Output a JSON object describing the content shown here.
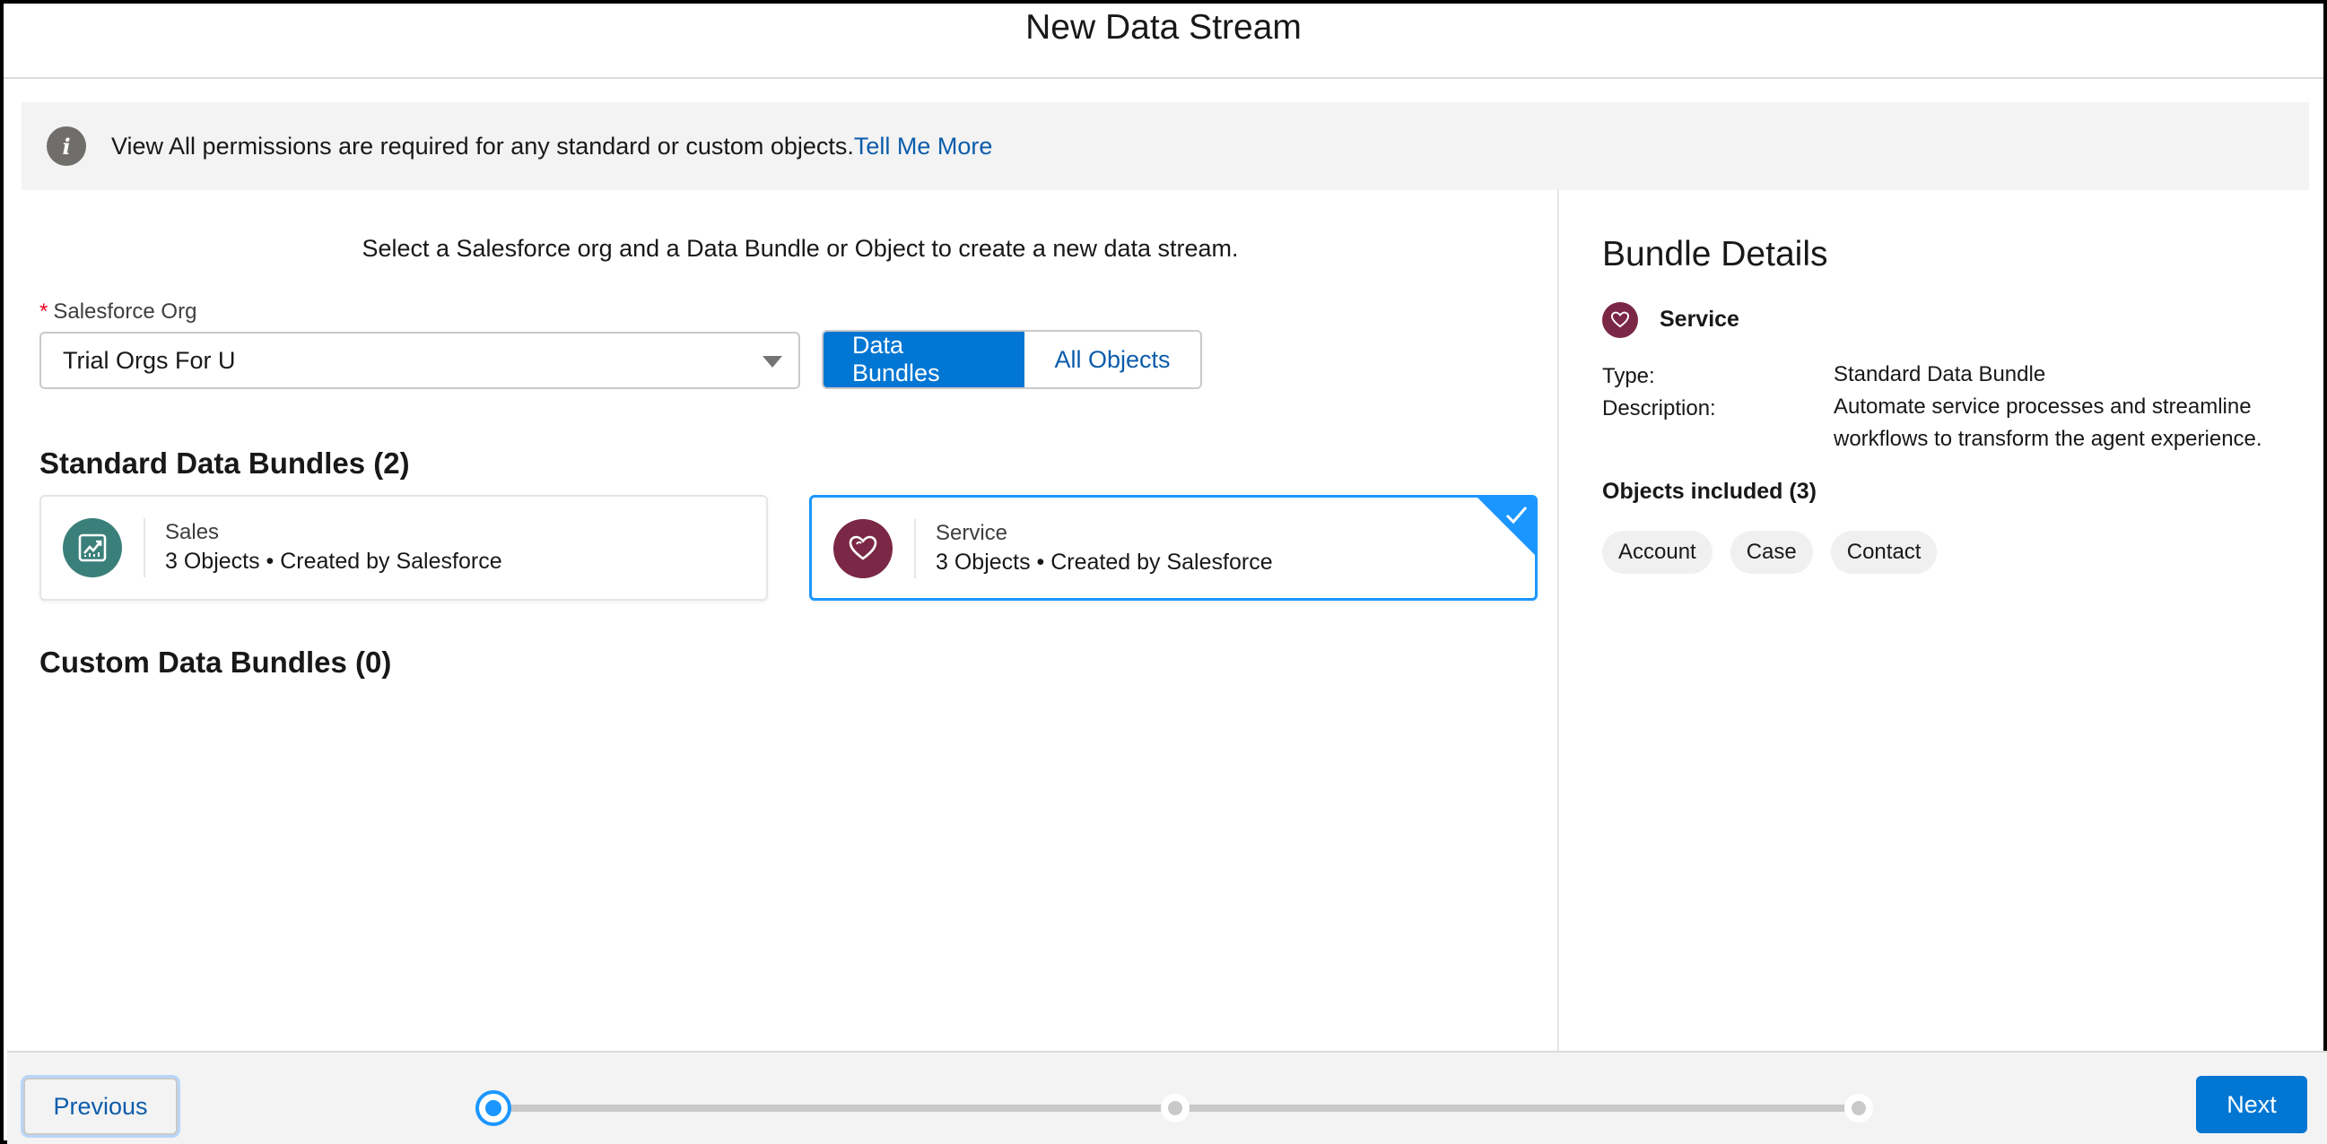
{
  "modal": {
    "title": "New Data Stream"
  },
  "banner": {
    "icon": "info-icon",
    "text": "View All permissions are required for any standard or custom objects.",
    "link": "Tell Me More"
  },
  "main": {
    "instruction": "Select a Salesforce org and a Data Bundle or Object to create a new data stream.",
    "org_field": {
      "required_marker": "*",
      "label": "Salesforce Org",
      "value": "Trial Orgs For U"
    },
    "toggle": {
      "selected": "Data Bundles",
      "options": [
        "Data Bundles",
        "All Objects"
      ]
    },
    "standard_section": {
      "title": "Standard Data Bundles (2)",
      "bundles": [
        {
          "name": "Sales",
          "meta": "3 Objects • Created by Salesforce",
          "icon": "chart-icon",
          "color": "#3a7f7a",
          "selected": false
        },
        {
          "name": "Service",
          "meta": "3 Objects • Created by Salesforce",
          "icon": "heart-icon",
          "color": "#7b2746",
          "selected": true
        }
      ]
    },
    "custom_section": {
      "title": "Custom Data Bundles (0)"
    }
  },
  "details": {
    "title": "Bundle Details",
    "bundle_name": "Service",
    "type_label": "Type:",
    "type_value": "Standard Data Bundle",
    "description_label": "Description:",
    "description_value": "Automate service processes and streamline workflows to transform the agent experience.",
    "objects_title": "Objects included (3)",
    "objects": [
      "Account",
      "Case",
      "Contact"
    ]
  },
  "footer": {
    "previous_label": "Previous",
    "next_label": "Next",
    "progress": {
      "steps": 3,
      "current": 1
    }
  },
  "colors": {
    "brand": "#0176d3",
    "link": "#0b5cab",
    "selected_border": "#1b96ff",
    "service": "#7b2746",
    "sales": "#3a7f7a"
  }
}
